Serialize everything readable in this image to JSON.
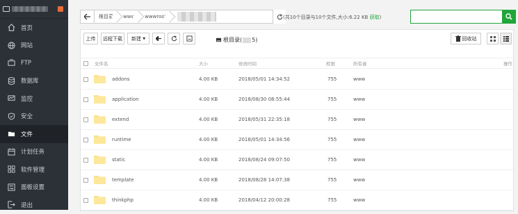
{
  "sidebar": {
    "items": [
      {
        "label": "首页",
        "icon": "home-icon",
        "active": false
      },
      {
        "label": "网站",
        "icon": "globe-icon",
        "active": false
      },
      {
        "label": "FTP",
        "icon": "ftp-icon",
        "active": false
      },
      {
        "label": "数据库",
        "icon": "database-icon",
        "active": false
      },
      {
        "label": "监控",
        "icon": "monitor-icon",
        "active": false
      },
      {
        "label": "安全",
        "icon": "shield-icon",
        "active": false
      },
      {
        "label": "文件",
        "icon": "folder-icon",
        "active": true
      },
      {
        "label": "计划任务",
        "icon": "calendar-icon",
        "active": false
      },
      {
        "label": "软件管理",
        "icon": "grid-icon",
        "active": false
      },
      {
        "label": "面板设置",
        "icon": "settings-icon",
        "active": false
      },
      {
        "label": "退出",
        "icon": "logout-icon",
        "active": false
      }
    ]
  },
  "breadcrumb": {
    "items": [
      "根目录",
      "www",
      "wwwroot"
    ]
  },
  "summary": {
    "text": "(共10个目录与10个文件,大小:6.22 KB",
    "get_link": "获取",
    "close": ")"
  },
  "search": {
    "placeholder": ""
  },
  "toolbar": {
    "upload": "上传",
    "remote_download": "远程下载",
    "new": "新建",
    "root_label_prefix": "根目录(",
    "root_label_suffix": "5)",
    "recycle_bin": "回收站"
  },
  "table": {
    "headers": {
      "name": "文件名",
      "size": "大小",
      "mtime": "修改时间",
      "perm": "权限",
      "owner": "所有者",
      "ops": "操作"
    },
    "rows": [
      {
        "name": "addons",
        "size": "4.00 KB",
        "mtime": "2018/05/01 14:34:52",
        "perm": "755",
        "owner": "www"
      },
      {
        "name": "application",
        "size": "4.00 KB",
        "mtime": "2018/08/30 08:55:44",
        "perm": "755",
        "owner": "www"
      },
      {
        "name": "extend",
        "size": "4.00 KB",
        "mtime": "2018/05/31 22:35:18",
        "perm": "755",
        "owner": "www"
      },
      {
        "name": "runtime",
        "size": "4.00 KB",
        "mtime": "2018/05/01 14:34:56",
        "perm": "755",
        "owner": "www"
      },
      {
        "name": "static",
        "size": "4.00 KB",
        "mtime": "2018/08/24 09:07:50",
        "perm": "755",
        "owner": "www"
      },
      {
        "name": "template",
        "size": "4.00 KB",
        "mtime": "2018/08/28 14:07:38",
        "perm": "755",
        "owner": "www"
      },
      {
        "name": "thinkphp",
        "size": "4.00 KB",
        "mtime": "2018/04/12 20:00:28",
        "perm": "755",
        "owner": "www"
      }
    ]
  },
  "colors": {
    "accent": "#20a53a",
    "sidebar_bg": "#2c3138",
    "folder": "#fbe08a"
  }
}
